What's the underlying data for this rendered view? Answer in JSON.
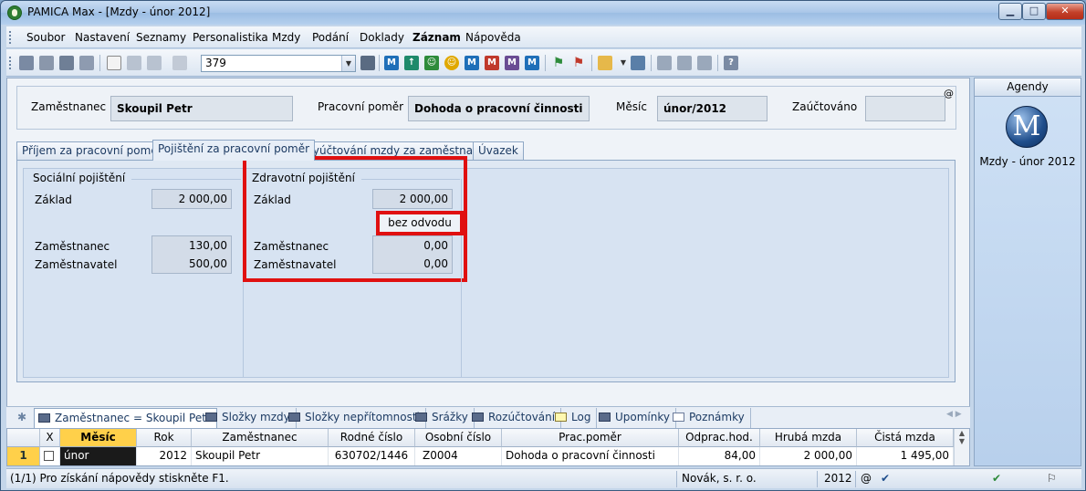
{
  "window": {
    "title": "PAMICA Max - [Mzdy - únor 2012]",
    "minimize": "▁",
    "maximize": "□",
    "close": "✕"
  },
  "menu": [
    "Soubor",
    "Nastavení",
    "Seznamy",
    "Personalistika",
    "Mzdy",
    "Podání",
    "Doklady",
    "Záznam",
    "Nápověda"
  ],
  "toolbar": {
    "record_number": "379"
  },
  "header": {
    "employee_label": "Zaměstnanec",
    "employee_value": "Skoupil Petr",
    "relation_label": "Pracovní poměr",
    "relation_value": "Dohoda o pracovní činnosti",
    "month_label": "Měsíc",
    "month_value": "únor/2012",
    "posted_label": "Zaúčtováno",
    "posted_value": "",
    "at_symbol": "@"
  },
  "tabs": [
    "Příjem za pracovní poměr",
    "Pojištění za pracovní poměr",
    "Vyúčtování mzdy za zaměstnance",
    "Úvazek"
  ],
  "social": {
    "title": "Sociální pojištění",
    "base_label": "Základ",
    "base_value": "2 000,00",
    "employee_label": "Zaměstnanec",
    "employee_value": "130,00",
    "employer_label": "Zaměstnavatel",
    "employer_value": "500,00"
  },
  "health": {
    "title": "Zdravotní pojištění",
    "base_label": "Základ",
    "base_value": "2 000,00",
    "no_payment": "bez odvodu",
    "employee_label": "Zaměstnanec",
    "employee_value": "0,00",
    "employer_label": "Zaměstnavatel",
    "employer_value": "0,00"
  },
  "bottom_tabs": [
    "Zaměstnanec = Skoupil Petr",
    "Složky mzdy",
    "Složky nepřítomnosti",
    "Srážky",
    "Rozúčtování",
    "Log",
    "Upomínky",
    "Poznámky"
  ],
  "grid": {
    "columns": [
      "X",
      "Měsíc",
      "Rok",
      "Zaměstnanec",
      "Rodné číslo",
      "Osobní číslo",
      "Prac.poměr",
      "Odprac.hod.",
      "Hrubá mzda",
      "Čistá mzda"
    ],
    "row": {
      "index": "1",
      "month": "únor",
      "year": "2012",
      "employee": "Skoupil Petr",
      "birth_number": "630702/1446",
      "personal_number": "Z0004",
      "relation": "Dohoda o pracovní činnosti",
      "hours": "84,00",
      "gross": "2 000,00",
      "net": "1 495,00"
    }
  },
  "agendy": {
    "title": "Agendy",
    "logo_letter": "M",
    "label": "Mzdy - únor 2012"
  },
  "status": {
    "help": "(1/1) Pro získání nápovědy stiskněte F1.",
    "company": "Novák, s. r. o.",
    "year": "2012",
    "at": "@"
  }
}
